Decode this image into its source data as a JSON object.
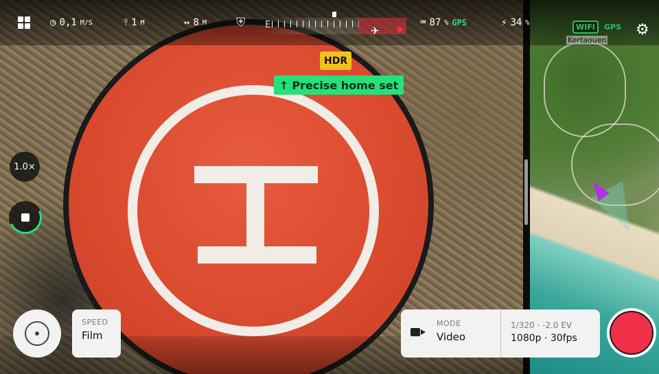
{
  "status_bar": {
    "speed_value": "0,1",
    "speed_unit": "M/S",
    "altitude_value": "1",
    "altitude_unit": "M",
    "distance_value": "8",
    "distance_unit": "M",
    "compass_label": "E",
    "controller_battery": "87",
    "controller_battery_unit": "%",
    "gps_label": "GPS",
    "drone_battery": "34",
    "drone_battery_unit": "%"
  },
  "overlays": {
    "hdr_badge": "HDR",
    "home_toast_icon": "↑",
    "home_toast": "Precise home set"
  },
  "left_controls": {
    "zoom": "1.0×"
  },
  "bottom": {
    "speed_label": "SPEED",
    "speed_value": "Film",
    "mode_label": "MODE",
    "mode_value": "Video",
    "exposure_line": "1/320 · -2.0 EV",
    "resolution_line": "1080p · 30fps"
  },
  "map": {
    "wifi_badge": "WIFI",
    "gps_badge": "GPS",
    "place_name": "Kertaouen"
  },
  "icons": {
    "grid": "grid-icon",
    "speed": "speedometer-icon",
    "altitude": "altitude-icon",
    "distance": "distance-icon",
    "shield": "shield-icon",
    "controller": "controller-icon",
    "drone_battery": "drone-battery-icon",
    "settings": "gear-icon",
    "record": "record-icon"
  },
  "colors": {
    "accent_green": "#26e07a",
    "hdr_yellow": "#f3c21a",
    "record_red": "#f1304a",
    "drone_arrow": "#b033e0"
  }
}
